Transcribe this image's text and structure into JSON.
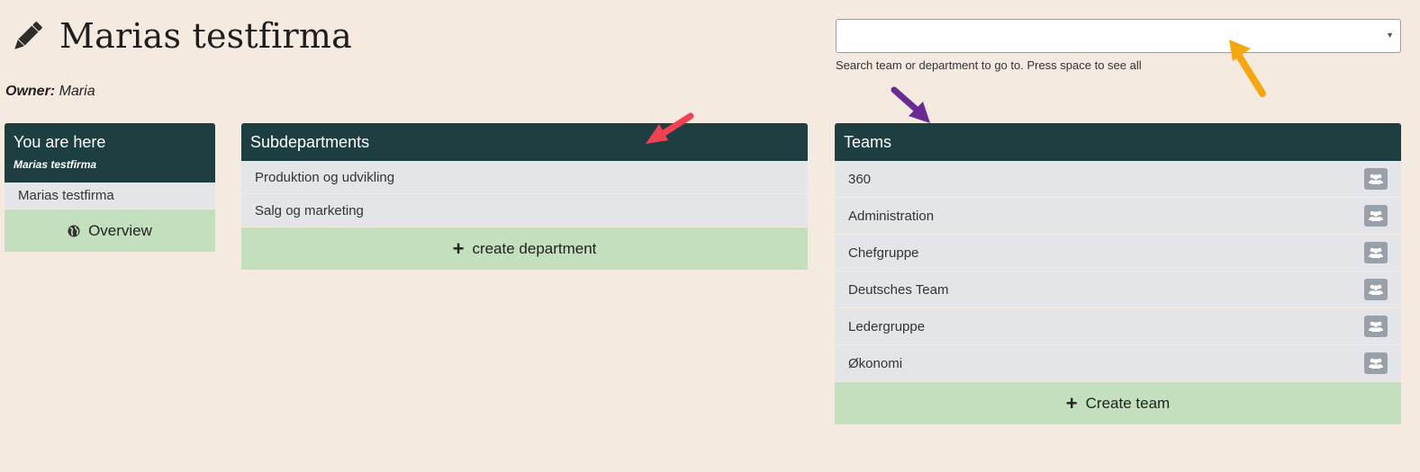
{
  "page": {
    "title": "Marias testfirma",
    "owner_label": "Owner:",
    "owner_name": "Maria",
    "colors": {
      "background": "#f4eadf",
      "header_bg": "#1e3f42",
      "action_bg": "#c3dfbe",
      "row_bg": "#e4e5e8"
    }
  },
  "search": {
    "value": "",
    "hint": "Search team or department to go to. Press space to see all"
  },
  "location_panel": {
    "title": "You are here",
    "subtitle": "Marias testfirma",
    "items": [
      {
        "label": "Marias testfirma"
      }
    ],
    "overview_label": "Overview"
  },
  "subdepartments_panel": {
    "title": "Subdepartments",
    "items": [
      {
        "label": "Produktion og udvikling"
      },
      {
        "label": "Salg og marketing"
      }
    ],
    "create_label": "create department"
  },
  "teams_panel": {
    "title": "Teams",
    "items": [
      {
        "label": "360"
      },
      {
        "label": "Administration"
      },
      {
        "label": "Chefgruppe"
      },
      {
        "label": "Deutsches Team"
      },
      {
        "label": "Ledergruppe"
      },
      {
        "label": "Økonomi"
      }
    ],
    "create_label": "Create team"
  },
  "annotations": {
    "arrow_colors": [
      "#f5a70f",
      "#f24150",
      "#6b2a91"
    ]
  }
}
